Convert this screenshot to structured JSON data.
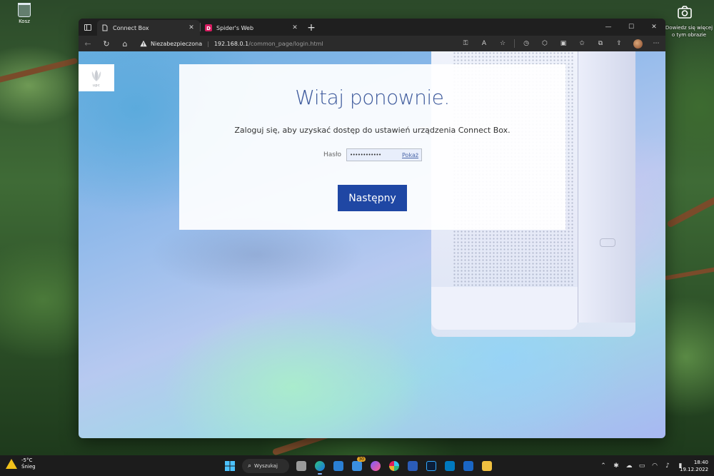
{
  "desktop": {
    "recycle_bin_label": "Kosz",
    "learn_more_text": "Dowiedz się więcej o tym obrazie"
  },
  "browser": {
    "tabs": [
      {
        "title": "Connect Box",
        "active": true,
        "favicon": "page-icon"
      },
      {
        "title": "Spider's Web",
        "active": false,
        "favicon": "spiders-web-icon"
      }
    ],
    "security_label": "Niezabezpieczona",
    "url_host": "192.168.0.1",
    "url_path": "/common_page/login.html"
  },
  "page": {
    "logo_text": "upc",
    "heading": "Witaj ponownie.",
    "subtitle": "Zaloguj się, aby uzyskać dostęp do ustawień urządzenia Connect Box.",
    "password_label": "Hasło",
    "password_value": "••••••••••••",
    "show_label": "Pokaż",
    "next_button": "Następny"
  },
  "taskbar": {
    "weather_temp": "-5°C",
    "weather_desc": "Śnieg",
    "search_label": "Wyszukaj",
    "mail_badge": "30",
    "time": "18:40",
    "date": "19.12.2022"
  },
  "colors": {
    "accent_button": "#1f47a4",
    "heading": "#3e5a9c"
  }
}
